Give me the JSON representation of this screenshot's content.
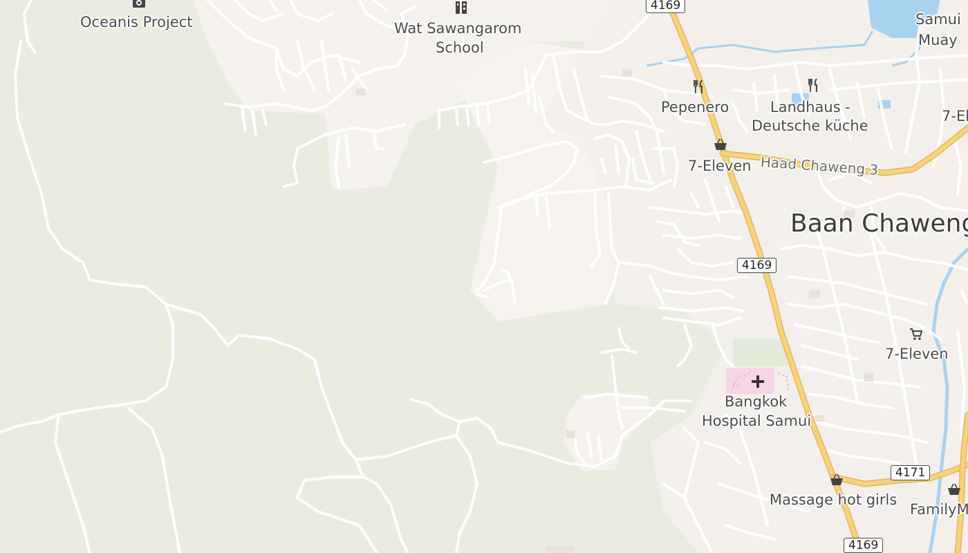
{
  "labels": {
    "oceanis": "Oceanis Project",
    "wat_line1": "Wat Sawangarom",
    "wat_line2": "School",
    "pepenero": "Pepenero",
    "landhaus_line1": "Landhaus -",
    "landhaus_line2": "Deutsche küche",
    "seven_eleven_1": "7-Eleven",
    "haad_chaweng": "Haad Chaweng 3",
    "baan_chaweng": "Baan Chaweng",
    "seven_eleven_2": "7-Eleven",
    "bangkok_line1": "Bangkok",
    "bangkok_line2": "Hospital Samui",
    "massage": "Massage hot girls",
    "familym": "FamilyM",
    "samui_line1": "Samui",
    "samui_line2": "Muay",
    "seven_el_partial": "7-El"
  },
  "shields": {
    "top": "4169",
    "mid": "4169",
    "bottom": "4169",
    "r4171": "4171"
  },
  "colors": {
    "forest": "#e9ecdf",
    "urban": "#f5f2ee",
    "road": "#ffffff",
    "highway": "#f7d27f",
    "water": "#a8d2f0",
    "hospital": "#f6d6e6"
  }
}
